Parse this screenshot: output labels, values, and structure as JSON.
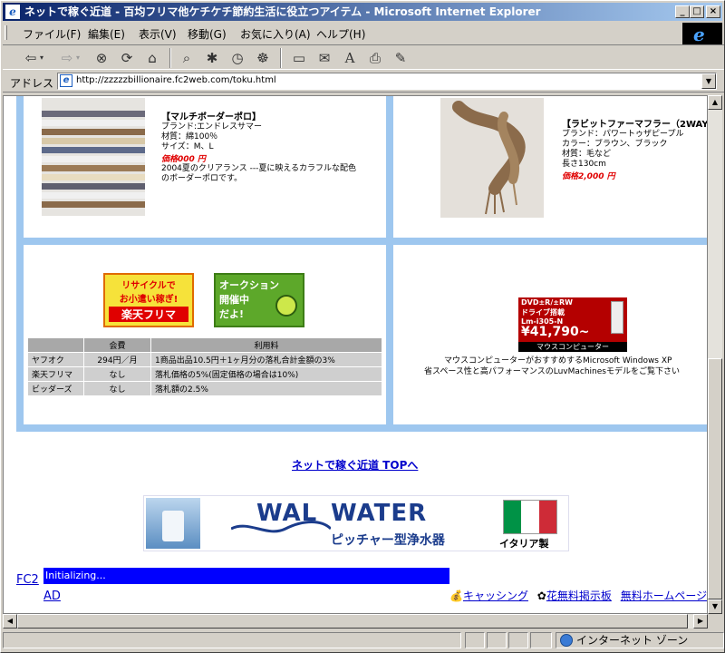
{
  "window": {
    "title": "ネットで稼ぐ近道 - 百均フリマ他ケチケチ節約生活に役立つアイテム - Microsoft Internet Explorer",
    "minimize": "_",
    "maximize": "□",
    "close": "×"
  },
  "menu": {
    "items": [
      "ファイル(F)",
      "編集(E)",
      "表示(V)",
      "移動(G)",
      "お気に入り(A)",
      "ヘルプ(H)"
    ]
  },
  "toolbar": {
    "back_icon": "back-arrow-icon",
    "forward_icon": "forward-arrow-icon",
    "stop_icon": "stop-icon",
    "refresh_icon": "refresh-icon",
    "home_icon": "home-icon",
    "search_icon": "search-icon",
    "favorites_icon": "favorites-icon",
    "history_icon": "history-icon",
    "channels_icon": "channels-icon",
    "fullscreen_icon": "fullscreen-icon",
    "mail_icon": "mail-icon",
    "font_icon": "font-icon",
    "print_icon": "print-icon",
    "edit_icon": "edit-icon"
  },
  "address": {
    "label": "アドレス",
    "url": "http://zzzzzbillionaire.fc2web.com/toku.html"
  },
  "products": {
    "polo": {
      "title": "【マルチボーダーポロ】",
      "brand": "ブランド:エンドレスサマー",
      "material": "材質：綿100％",
      "size": "サイズ：M、L",
      "price": "価格000 円",
      "desc1": "2004夏のクリアランス ---夏に映えるカラフルな配色",
      "desc2": "のボーダーポロです。"
    },
    "scarf": {
      "title": "【ラビットファーマフラー（2WAY",
      "brand": "ブランド：パワートゥザピープル",
      "color": "カラー：ブラウン、ブラック",
      "material": "材質：毛など",
      "length": "長さ130cm",
      "price": "価格2,000 円"
    }
  },
  "banners": {
    "rakuten_line1": "リサイクルで",
    "rakuten_line2": "お小遣い稼ぎ!",
    "rakuten_line3": "楽天フリマ",
    "auction_line1": "オークション",
    "auction_line2": "開催中",
    "auction_line3": "だよ!"
  },
  "fee_table": {
    "headers": [
      "",
      "会費",
      "利用料"
    ],
    "rows": [
      [
        "ヤフオク",
        "294円／月",
        "1商品出品10.5円＋1ヶ月分の落札合計金額の3%"
      ],
      [
        "楽天フリマ",
        "なし",
        "落札価格の5%(固定価格の場合は10%)"
      ],
      [
        "ビッダーズ",
        "なし",
        "落札額の2.5%"
      ]
    ]
  },
  "pc_ad": {
    "line1": "DVD±R/±RW",
    "line2": "ドライブ搭載",
    "model": "Lm-i305-N",
    "price": "¥41,790~",
    "brand": "マウスコンピューター",
    "desc1": "マウスコンピューターがおすすめするMicrosoft Windows XP",
    "desc2": "省スペース性と高パフォーマンスのLuvMachinesモデルをご覧下さい"
  },
  "links": {
    "top": "ネットで稼ぐ近道 TOPへ"
  },
  "water_banner": {
    "brand1": "WAL",
    "brand2": "WATER",
    "product": "ピッチャー型浄水器",
    "origin": "イタリア製"
  },
  "fc2": {
    "label1": "FC2",
    "label2": "AD",
    "status": "Initializing...",
    "link1": "キャッシング",
    "link2": "花無料掲示板",
    "link3": "無料ホームページ"
  },
  "status": {
    "zone": "インターネット ゾーン"
  }
}
